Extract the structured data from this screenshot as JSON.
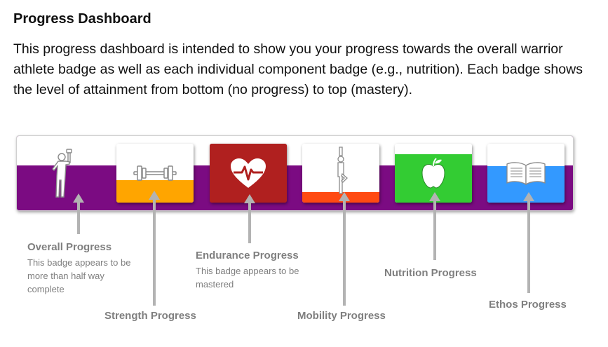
{
  "title": "Progress Dashboard",
  "intro": "This progress dashboard is intended to show you your progress towards the overall warrior athlete badge as well as each individual component badge (e.g., nutrition). Each badge shows the level of attainment from bottom (no progress) to top (mastery).",
  "colors": {
    "overall": "#7b0b82",
    "strength": "#ffa500",
    "endurance": "#b0201f",
    "mobility": "#ff4a12",
    "nutrition": "#33cc33",
    "ethos": "#3399ff",
    "arrow": "#b3b3b3",
    "label": "#7f7f7f"
  },
  "badges": {
    "overall": {
      "icon": "warrior-athlete-icon",
      "progress": 0.62
    },
    "strength": {
      "icon": "barbell-icon",
      "progress": 0.38
    },
    "endurance": {
      "icon": "heart-pulse-icon",
      "progress": 1.0
    },
    "mobility": {
      "icon": "yoga-pose-icon",
      "progress": 0.18
    },
    "nutrition": {
      "icon": "apple-icon",
      "progress": 0.82
    },
    "ethos": {
      "icon": "open-book-icon",
      "progress": 0.62
    }
  },
  "labels": {
    "overall": "Overall Progress",
    "overall_note": "This badge appears to be more than half way complete",
    "strength": "Strength Progress",
    "endurance": "Endurance Progress",
    "endurance_note": "This badge appears to be mastered",
    "mobility": "Mobility Progress",
    "nutrition": "Nutrition Progress",
    "ethos": "Ethos Progress"
  }
}
